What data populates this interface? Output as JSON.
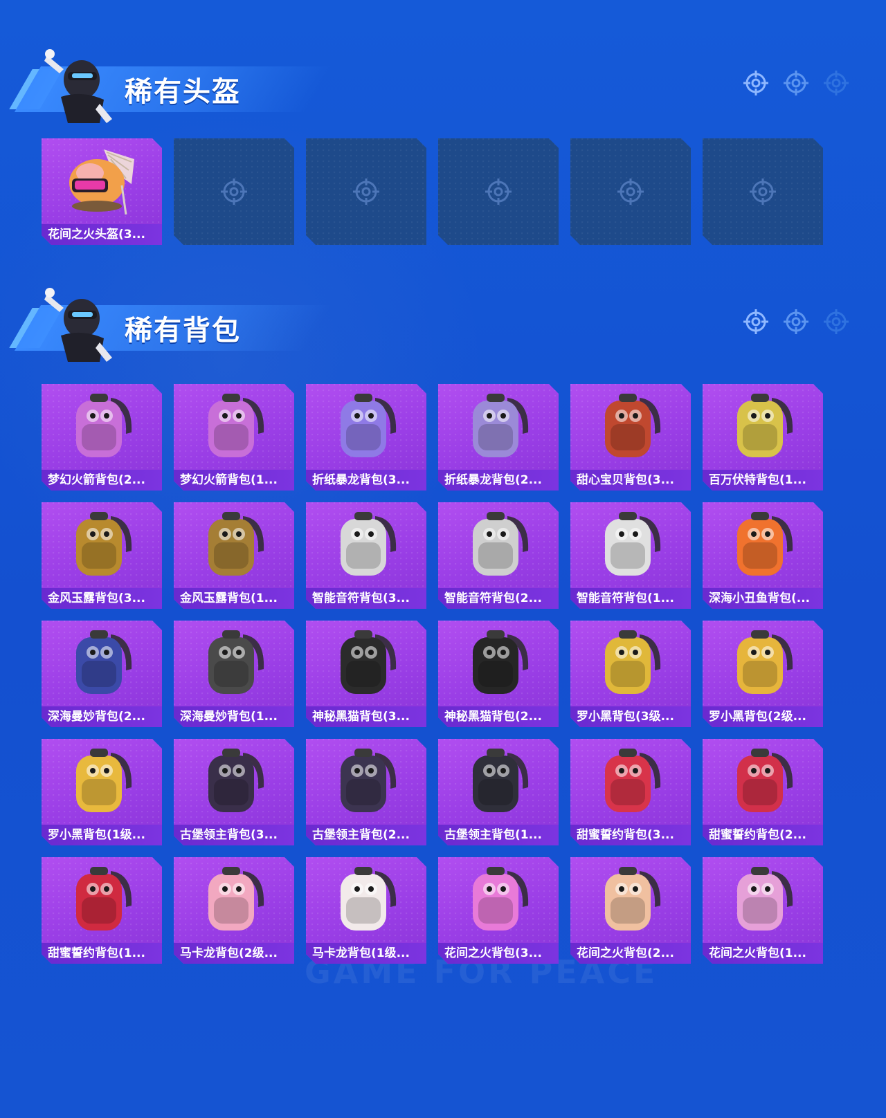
{
  "colors": {
    "background": "#1656d6",
    "card_purple": "#9a3ee6",
    "card_label": "#7030d8",
    "card_empty": "#1e4a8a",
    "header_stripe": "#3a8bff"
  },
  "watermark": "GAME FOR PEACE",
  "sections": [
    {
      "title": "稀有头盔",
      "items": [
        {
          "label": "花间之火头盔(3...",
          "icon": "helmet-icon",
          "color": "#f2a04a"
        },
        {
          "label": "",
          "icon": "empty-slot-icon"
        },
        {
          "label": "",
          "icon": "empty-slot-icon"
        },
        {
          "label": "",
          "icon": "empty-slot-icon"
        },
        {
          "label": "",
          "icon": "empty-slot-icon"
        },
        {
          "label": "",
          "icon": "empty-slot-icon"
        }
      ]
    },
    {
      "title": "稀有背包",
      "items": [
        {
          "label": "梦幻火箭背包(2...",
          "icon": "backpack-icon",
          "color": "#c86fd8"
        },
        {
          "label": "梦幻火箭背包(1...",
          "icon": "backpack-icon",
          "color": "#c86fd8"
        },
        {
          "label": "折纸暴龙背包(3...",
          "icon": "backpack-icon",
          "color": "#8f7ae6"
        },
        {
          "label": "折纸暴龙背包(2...",
          "icon": "backpack-icon",
          "color": "#9b8ad8"
        },
        {
          "label": "甜心宝贝背包(3...",
          "icon": "backpack-icon",
          "color": "#c0482f"
        },
        {
          "label": "百万伏特背包(1...",
          "icon": "backpack-icon",
          "color": "#d8c24a"
        },
        {
          "label": "金风玉露背包(3...",
          "icon": "backpack-icon",
          "color": "#b88a2e"
        },
        {
          "label": "金风玉露背包(1...",
          "icon": "backpack-icon",
          "color": "#a57e35"
        },
        {
          "label": "智能音符背包(3...",
          "icon": "backpack-icon",
          "color": "#d8d8d8"
        },
        {
          "label": "智能音符背包(2...",
          "icon": "backpack-icon",
          "color": "#cfcfcf"
        },
        {
          "label": "智能音符背包(1...",
          "icon": "backpack-icon",
          "color": "#e0e0e0"
        },
        {
          "label": "深海小丑鱼背包(...",
          "icon": "backpack-icon",
          "color": "#f0722e"
        },
        {
          "label": "深海曼妙背包(2...",
          "icon": "backpack-icon",
          "color": "#3b4aa8"
        },
        {
          "label": "深海曼妙背包(1...",
          "icon": "backpack-icon",
          "color": "#4a4a4a"
        },
        {
          "label": "神秘黑猫背包(3...",
          "icon": "backpack-icon",
          "color": "#2b2b2b"
        },
        {
          "label": "神秘黑猫背包(2...",
          "icon": "backpack-icon",
          "color": "#262626"
        },
        {
          "label": "罗小黑背包(3级...",
          "icon": "backpack-icon",
          "color": "#e0b83a"
        },
        {
          "label": "罗小黑背包(2级...",
          "icon": "backpack-icon",
          "color": "#e6b53c"
        },
        {
          "label": "罗小黑背包(1级...",
          "icon": "backpack-icon",
          "color": "#e8b93d"
        },
        {
          "label": "古堡领主背包(3...",
          "icon": "backpack-icon",
          "color": "#3a2f4a"
        },
        {
          "label": "古堡领主背包(2...",
          "icon": "backpack-icon",
          "color": "#3c3450"
        },
        {
          "label": "古堡领主背包(1...",
          "icon": "backpack-icon",
          "color": "#2f2f3a"
        },
        {
          "label": "甜蜜誓约背包(3...",
          "icon": "backpack-icon",
          "color": "#d8344a"
        },
        {
          "label": "甜蜜誓约背包(2...",
          "icon": "backpack-icon",
          "color": "#d2304a"
        },
        {
          "label": "甜蜜誓约背包(1...",
          "icon": "backpack-icon",
          "color": "#d02a40"
        },
        {
          "label": "马卡龙背包(2级...",
          "icon": "backpack-icon",
          "color": "#f2a8c0"
        },
        {
          "label": "马卡龙背包(1级...",
          "icon": "backpack-icon",
          "color": "#f2eaea"
        },
        {
          "label": "花间之火背包(3...",
          "icon": "backpack-icon",
          "color": "#e87ad8"
        },
        {
          "label": "花间之火背包(2...",
          "icon": "backpack-icon",
          "color": "#f0c0a0"
        },
        {
          "label": "花间之火背包(1...",
          "icon": "backpack-icon",
          "color": "#e6a0d8"
        }
      ]
    }
  ]
}
